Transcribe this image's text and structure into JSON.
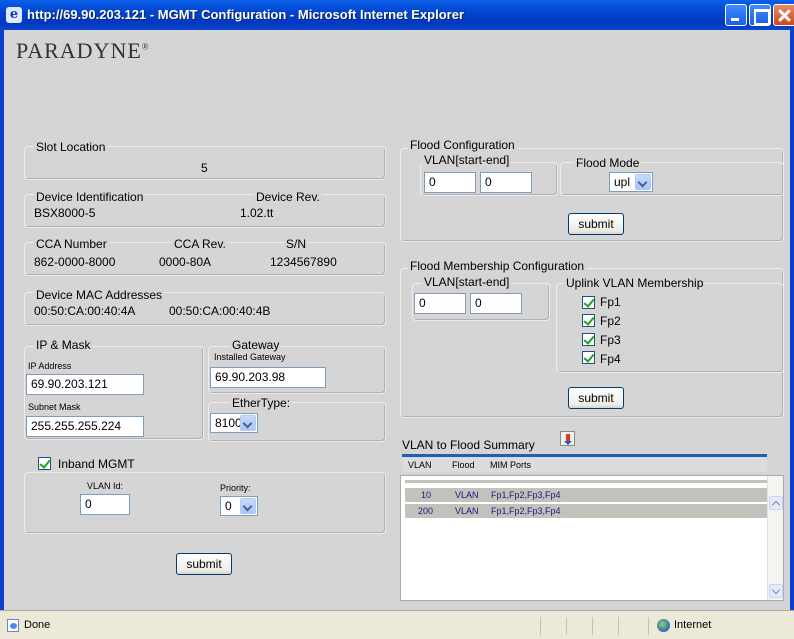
{
  "window": {
    "title": "http://69.90.203.121 - MGMT Configuration - Microsoft Internet Explorer"
  },
  "brand": {
    "logo": "PARADYNE",
    "mark": "®"
  },
  "slot": {
    "label": "Slot Location",
    "value": "5"
  },
  "device": {
    "id_label": "Device Identification",
    "id_value": "BSX8000-5",
    "rev_label": "Device Rev.",
    "rev_value": "1.02.tt"
  },
  "cca": {
    "number_label": "CCA Number",
    "number_value": "862-0000-8000",
    "rev_label": "CCA Rev.",
    "rev_value": "0000-80A",
    "sn_label": "S/N",
    "sn_value": "1234567890"
  },
  "mac": {
    "label": "Device MAC Addresses",
    "value1": "00:50:CA:00:40:4A",
    "value2": "00:50:CA:00:40:4B"
  },
  "ipmask": {
    "legend": "IP & Mask",
    "ip_label": "IP Address",
    "ip_value": "69.90.203.121",
    "mask_label": "Subnet Mask",
    "mask_value": "255.255.255.224"
  },
  "gateway": {
    "legend": "Gateway",
    "installed_label": "Installed Gateway",
    "installed_value": "69.90.203.98"
  },
  "ethertype": {
    "legend": "EtherType:",
    "value": "8100"
  },
  "inband": {
    "label": "Inband MGMT",
    "vlan_label": "VLAN Id:",
    "vlan_value": "0",
    "priority_label": "Priority:",
    "priority_value": "0"
  },
  "left_submit": "submit",
  "flood_config": {
    "legend": "Flood Configuration",
    "vlan_label": "VLAN[start-end]",
    "start": "0",
    "end": "0",
    "mode_label": "Flood Mode",
    "mode_value": "upl",
    "submit": "submit"
  },
  "flood_membership": {
    "legend": "Flood Membership Configuration",
    "vlan_label": "VLAN[start-end]",
    "start": "0",
    "end": "0",
    "uplink_label": "Uplink VLAN Membership",
    "ports": [
      "Fp1",
      "Fp2",
      "Fp3",
      "Fp4"
    ],
    "submit": "submit"
  },
  "summary": {
    "title": "VLAN to Flood Summary",
    "headers": [
      "VLAN",
      "Flood",
      "MIM Ports"
    ],
    "rows": [
      {
        "vlan": "10",
        "flood": "VLAN",
        "ports": "Fp1,Fp2,Fp3,Fp4"
      },
      {
        "vlan": "200",
        "flood": "VLAN",
        "ports": "Fp1,Fp2,Fp3,Fp4"
      }
    ]
  },
  "status": {
    "left": "Done",
    "zone": "Internet"
  }
}
